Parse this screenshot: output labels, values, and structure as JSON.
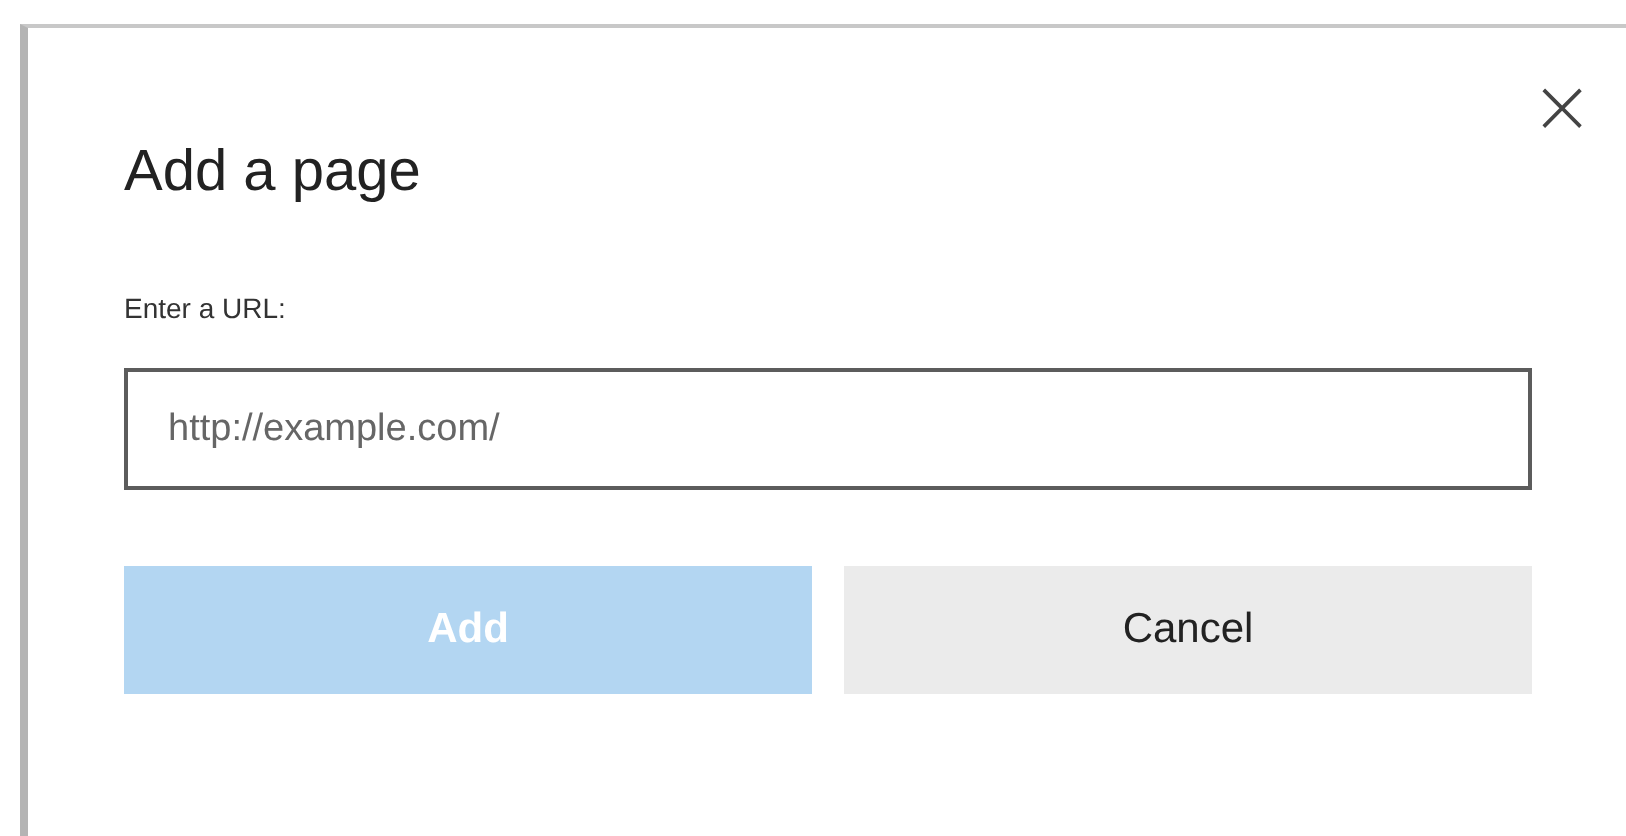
{
  "dialog": {
    "title": "Add a page",
    "close": "×",
    "label": "Enter a URL:",
    "url_field": {
      "placeholder": "http://example.com/"
    },
    "buttons": [
      {
        "label": "Add",
        "kind": "primary",
        "disabled": true
      },
      {
        "label": "Cancel",
        "kind": "secondary",
        "disabled": false
      }
    ]
  }
}
